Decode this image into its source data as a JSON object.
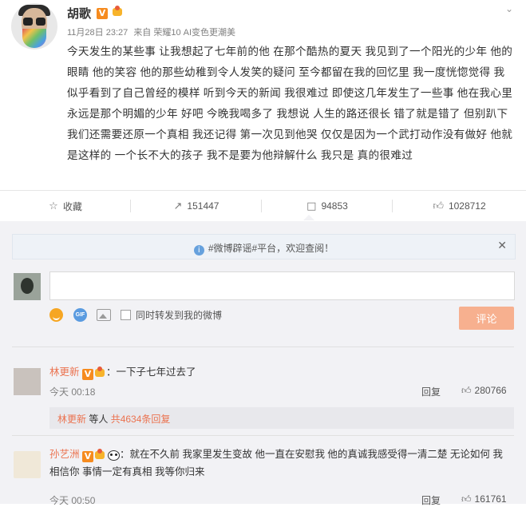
{
  "post": {
    "username": "胡歌",
    "v_badge": "V",
    "date": "11月28日 23:27",
    "source_prefix": "来自",
    "source": "荣耀10 AI变色更潮美",
    "content": "今天发生的某些事 让我想起了七年前的他 在那个酷热的夏天 我见到了一个阳光的少年 他的眼睛 他的笑容 他的那些幼稚到令人发笑的疑问 至今都留在我的回忆里 我一度恍惚觉得 我似乎看到了自己曾经的模样 听到今天的新闻 我很难过 即使这几年发生了一些事 他在我心里永远是那个明媚的少年 好吧 今晚我喝多了 我想说 人生的路还很长 错了就是错了 但别趴下 我们还需要还原一个真相 我还记得 第一次见到他哭 仅仅是因为一个武打动作没有做好 他就是这样的 一个长不大的孩子 我不是要为他辩解什么 我只是 真的很难过"
  },
  "actions": {
    "favorite_label": "收藏",
    "repost_count": "151447",
    "comment_count": "94853",
    "like_count": "1028712"
  },
  "notice": {
    "text": "#微博辟谣#平台，欢迎查阅！"
  },
  "composer": {
    "input_value": "",
    "also_repost_label": "同时转发到我的微博",
    "submit_label": "评论",
    "gif_label": "GIF"
  },
  "comments": [
    {
      "name": "林更新",
      "text": "：一下子七年过去了",
      "time": "今天 00:18",
      "reply_label": "回复",
      "likes": "280766",
      "sub_name": "林更新",
      "sub_text": " 等人 ",
      "sub_count": "共4634条回复"
    },
    {
      "name": "孙艺洲",
      "text": "：就在不久前 我家里发生变故 他一直在安慰我 他的真诚我感受得一清二楚 无论如何 我相信你 事情一定有真相 我等你归来",
      "time": "今天 00:50",
      "reply_label": "回复",
      "likes": "161761"
    }
  ],
  "icons": {
    "star": "star-icon",
    "repost": "repost-icon",
    "comment": "comment-icon",
    "like": "thumbs-up-icon",
    "info": "info-icon",
    "close": "close-icon"
  },
  "colors": {
    "accent_name": "#eb7350",
    "submit_button": "#f7b08f",
    "v_badge": "#f68b1f",
    "comment_bg": "#f2f2f5"
  }
}
